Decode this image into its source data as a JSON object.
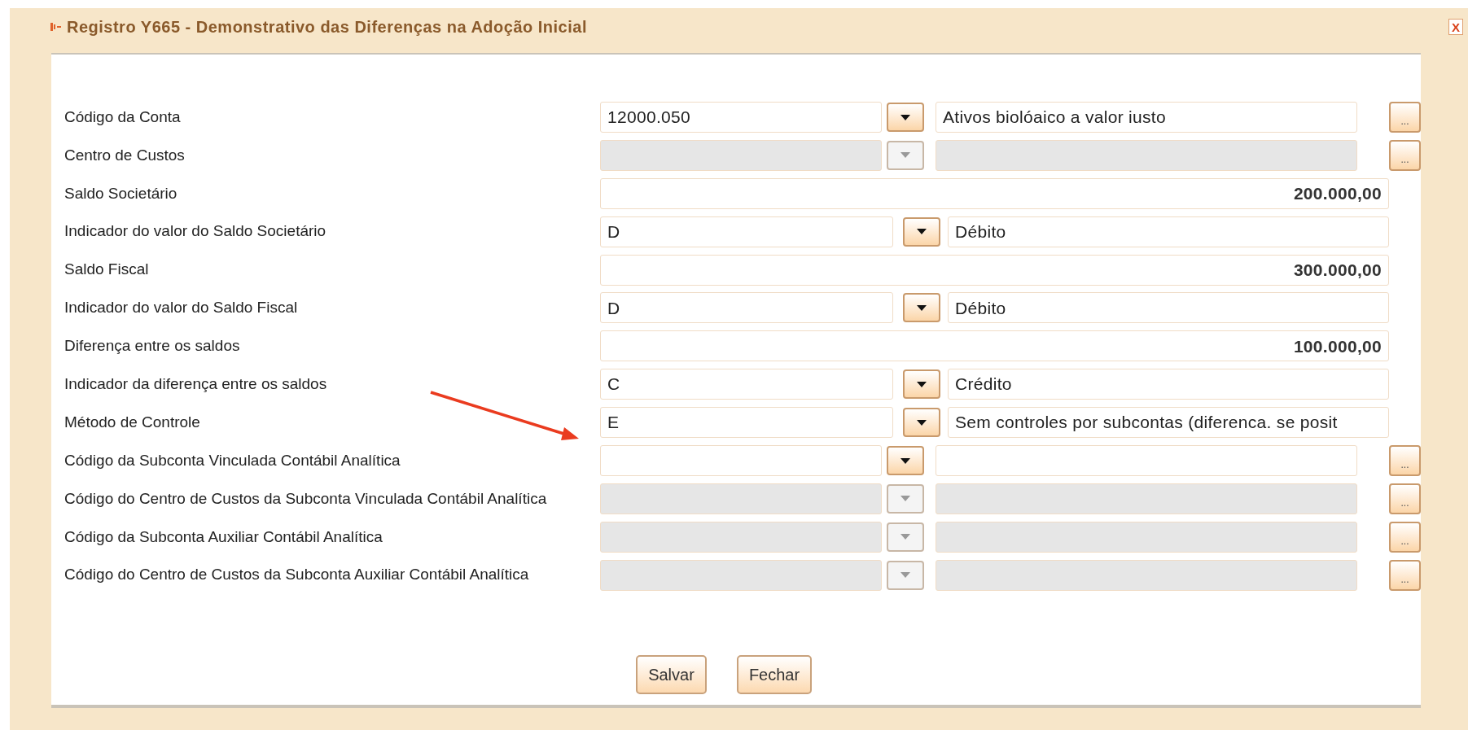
{
  "window": {
    "title": "Registro Y665 - Demonstrativo das Diferenças na Adoção Inicial",
    "close": "X"
  },
  "rows": [
    {
      "label": "Código da Conta",
      "kind": "lookup",
      "code": "12000.050",
      "description": "Ativos biolóaico a valor iusto",
      "disabled": false,
      "more": "..."
    },
    {
      "label": "Centro de Custos",
      "kind": "lookup",
      "disabled": true,
      "more": "..."
    },
    {
      "label": "Saldo Societário",
      "kind": "amount",
      "value": "200.000,00"
    },
    {
      "label": "Indicador do valor do Saldo Societário",
      "kind": "select",
      "code": "D",
      "description": "Débito"
    },
    {
      "label": "Saldo Fiscal",
      "kind": "amount",
      "value": "300.000,00"
    },
    {
      "label": "Indicador do valor do Saldo Fiscal",
      "kind": "select",
      "code": "D",
      "description": "Débito"
    },
    {
      "label": "Diferença entre os saldos",
      "kind": "amount",
      "value": "100.000,00"
    },
    {
      "label": "Indicador da diferença entre os saldos",
      "kind": "select",
      "code": "C",
      "description": "Crédito"
    },
    {
      "label": "Método de Controle",
      "kind": "select",
      "code": "E",
      "description": "Sem controles por subcontas (diferenca. se posit"
    },
    {
      "label": "Código da Subconta Vinculada Contábil Analítica",
      "kind": "lookup",
      "disabled": false,
      "more": "..."
    },
    {
      "label": "Código do Centro de Custos da Subconta Vinculada Contábil Analítica",
      "kind": "lookup",
      "disabled": true,
      "more": "..."
    },
    {
      "label": "Código da Subconta Auxiliar Contábil Analítica",
      "kind": "lookup",
      "disabled": true,
      "more": "..."
    },
    {
      "label": "Código do Centro de Custos da Subconta Auxiliar Contábil Analítica",
      "kind": "lookup",
      "disabled": true,
      "more": "..."
    }
  ],
  "buttons": [
    "Salvar",
    "Fechar"
  ]
}
